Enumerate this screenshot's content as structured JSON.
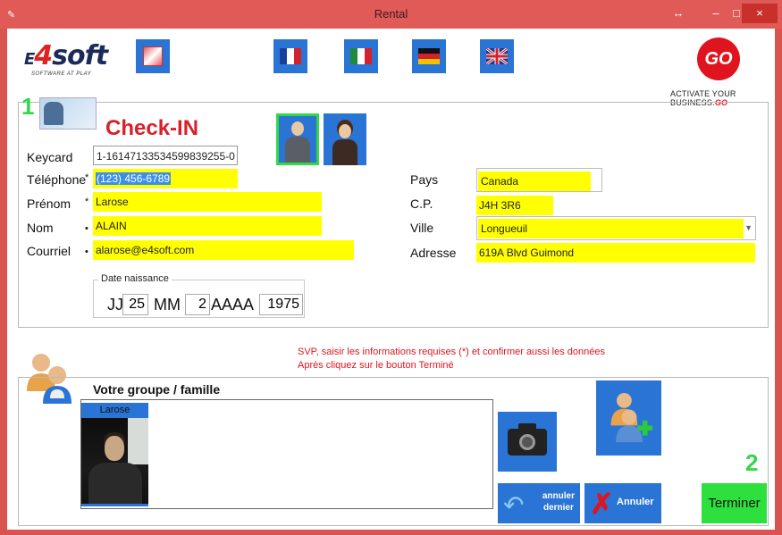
{
  "window": {
    "title": "Rental",
    "restore_glyph": "↔",
    "minimize_glyph": "–",
    "maximize_glyph": "□",
    "close_glyph": "×"
  },
  "branding": {
    "left_logo_text_e": "E",
    "left_logo_text_4": "4",
    "left_logo_text_soft": "soft",
    "left_logo_tagline": "SOFTWARE AT PLAY",
    "right_logo_text": "GO",
    "right_tagline": "ACTIVATE YOUR BUSINESS.",
    "right_tagline_go": "GO"
  },
  "toolbar": {
    "icons": [
      "clear-form-icon",
      "flag-fr-icon",
      "flag-it-icon",
      "flag-de-icon",
      "flag-uk-icon"
    ]
  },
  "steps": {
    "step1": "1",
    "step2": "2"
  },
  "checkin": {
    "title": "Check-IN"
  },
  "form": {
    "keycard_label": "Keycard",
    "keycard_value": "1-16147133534599839255-0",
    "telephone_label": "Téléphone",
    "telephone_value": "(123) 456-6789",
    "prenom_label": "Prénom",
    "prenom_value": "Larose",
    "nom_label": "Nom",
    "nom_value": "ALAIN",
    "courriel_label": "Courriel",
    "courriel_value": "alarose@e4soft.com",
    "pays_label": "Pays",
    "pays_value": "Canada",
    "cp_label": "C.P.",
    "cp_value": "J4H 3R6",
    "ville_label": "Ville",
    "ville_value": "Longueuil",
    "adresse_label": "Adresse",
    "adresse_value": "619A Blvd Guimond",
    "required_mark": "*",
    "bullet_mark": "•"
  },
  "birth": {
    "legend": "Date naissance",
    "jj_label": "JJ",
    "jj_value": "25",
    "mm_label": "MM",
    "mm_value": "2",
    "aaaa_label": "AAAA",
    "aaaa_value": "1975"
  },
  "message": {
    "line1": "SVP, saisir les informations requises (*) et confirmer aussi les données",
    "line2": "Après cliquez sur le bouton Terminé"
  },
  "group": {
    "title": "Votre groupe / famille",
    "members": [
      {
        "name": "Larose"
      }
    ]
  },
  "buttons": {
    "undo_line1": "annuler",
    "undo_line2": "dernier",
    "cancel": "Annuler",
    "finish": "Terminer"
  },
  "colors": {
    "accent_blue": "#2a74d6",
    "field_yellow": "#ffff00",
    "title_red": "#d8202a",
    "step_green": "#34d74a",
    "finish_green": "#2de03e",
    "chrome_red": "#e05a57"
  }
}
